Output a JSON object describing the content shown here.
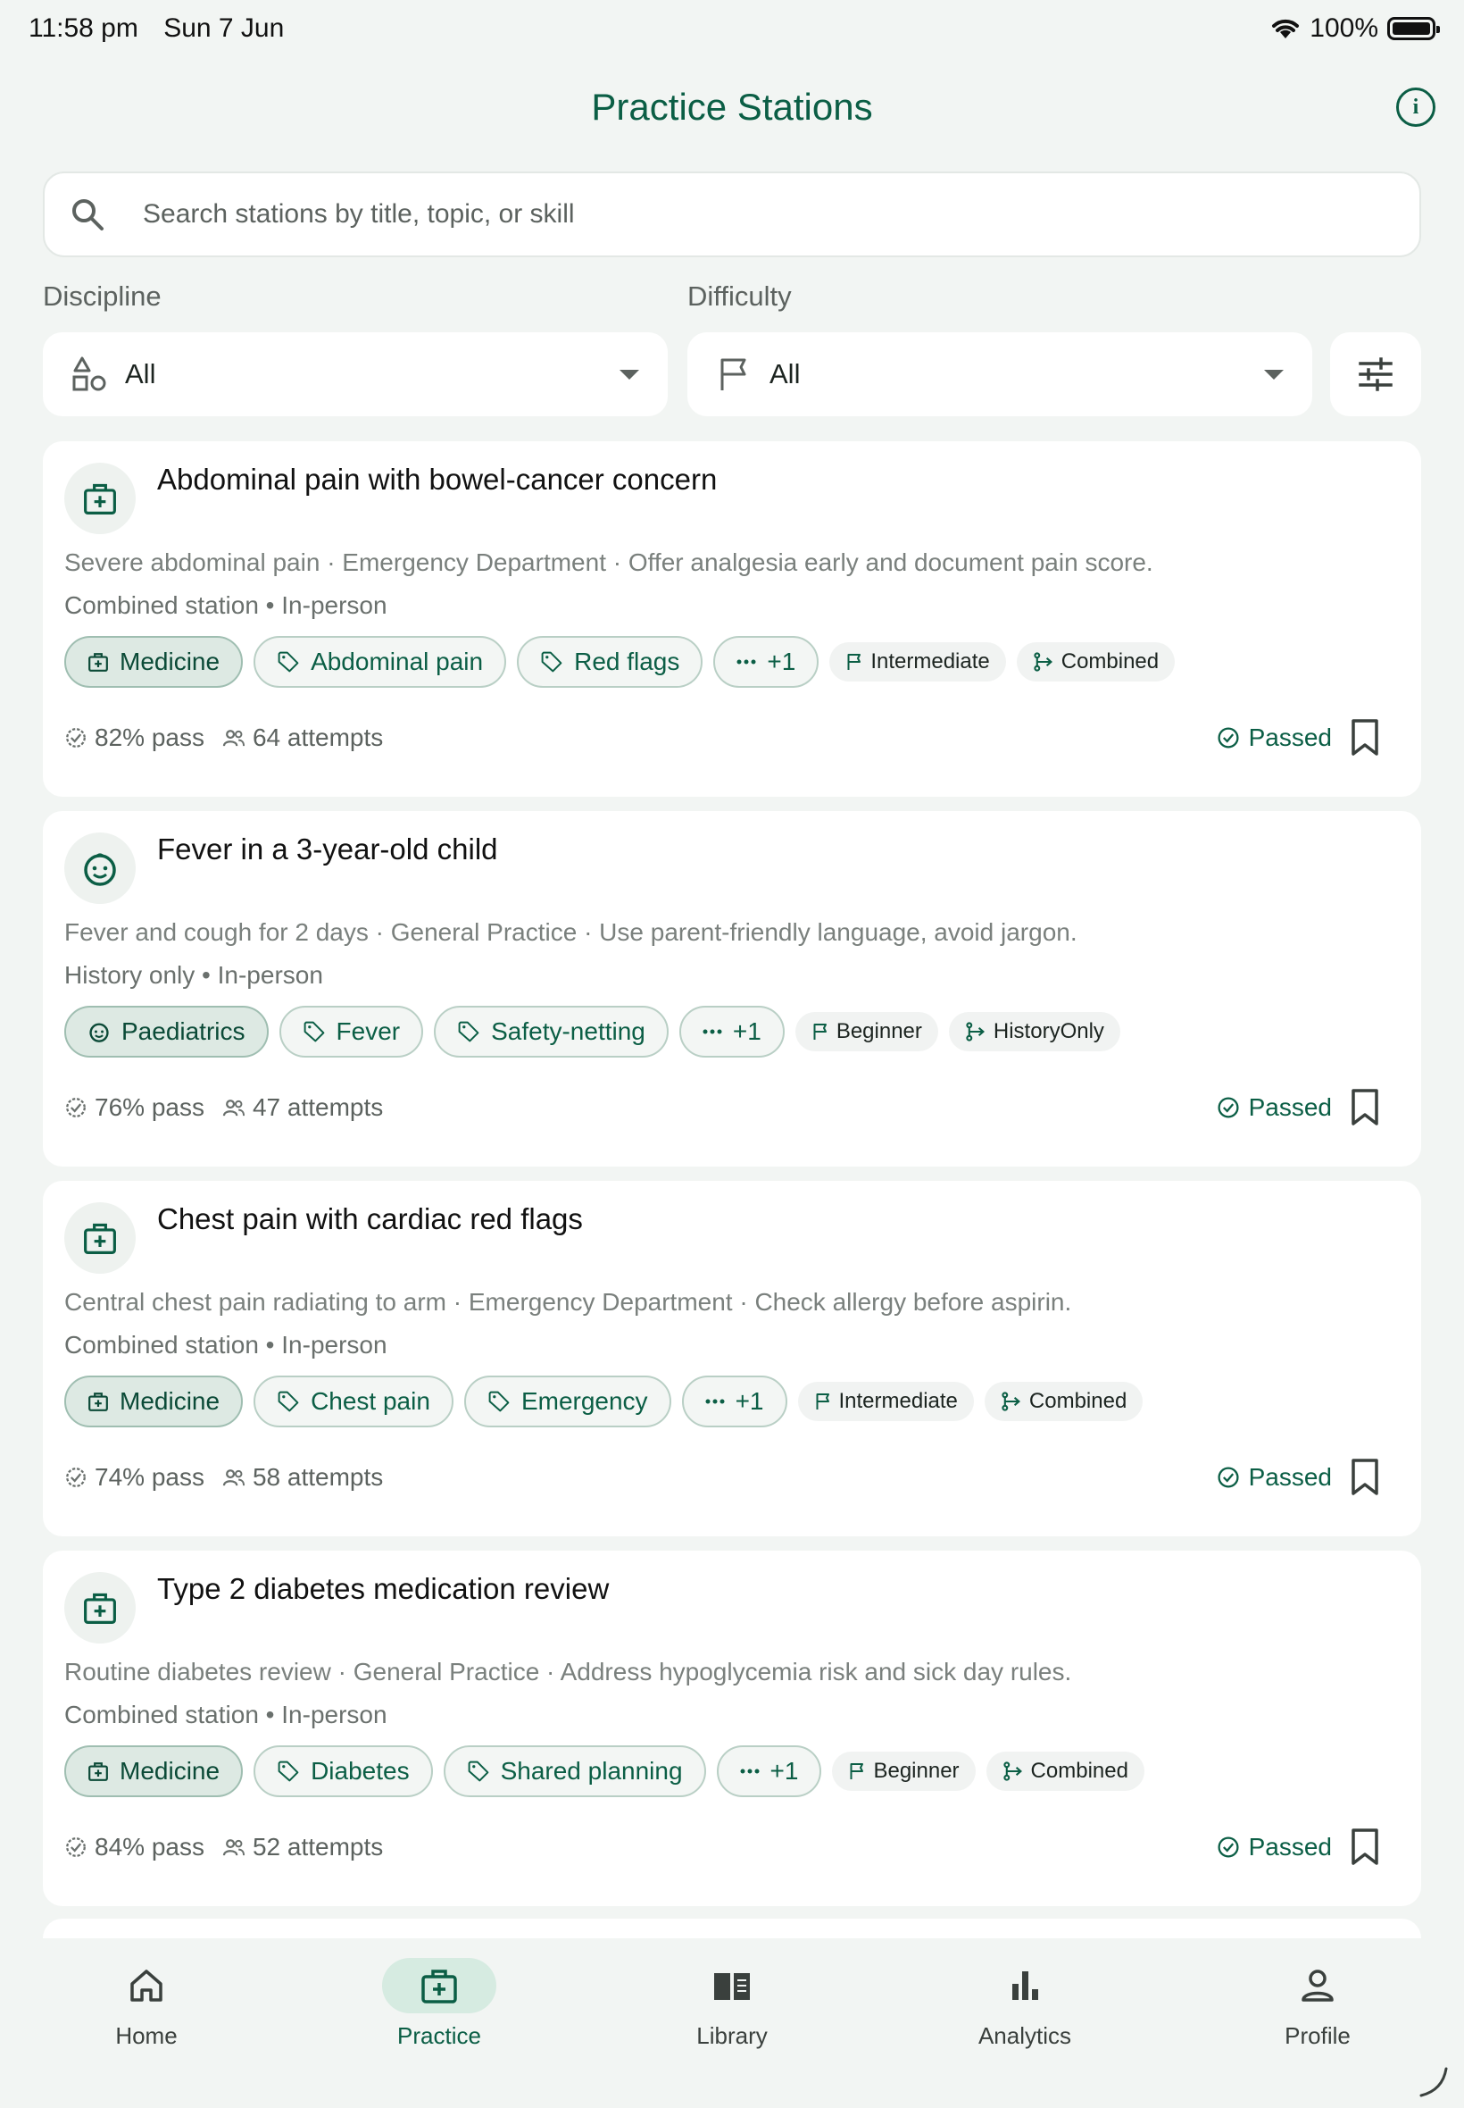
{
  "status_bar": {
    "time": "11:58 pm",
    "date": "Sun 7 Jun",
    "battery": "100%"
  },
  "header": {
    "title": "Practice Stations"
  },
  "search": {
    "placeholder": "Search stations by title, topic, or skill"
  },
  "filters": {
    "discipline": {
      "label": "Discipline",
      "value": "All"
    },
    "difficulty": {
      "label": "Difficulty",
      "value": "All"
    }
  },
  "colors": {
    "brand": "#0b5e45",
    "chip_active": "#dde9e3",
    "background": "#f2f5f3"
  },
  "stations": [
    {
      "icon": "medical-kit-icon",
      "title": "Abdominal pain with bowel-cancer concern",
      "description": "Severe abdominal pain · Emergency Department · Offer analgesia early and document pain score.",
      "meta": "Combined station • In-person",
      "discipline": "Medicine",
      "tags": [
        "Abdominal pain",
        "Red flags"
      ],
      "more": "+1",
      "difficulty": "Intermediate",
      "type": "Combined",
      "pass": "82% pass",
      "attempts": "64 attempts",
      "status": "Passed"
    },
    {
      "icon": "child-face-icon",
      "title": "Fever in a 3-year-old child",
      "description": "Fever and cough for 2 days · General Practice · Use parent-friendly language, avoid jargon.",
      "meta": "History only • In-person",
      "discipline": "Paediatrics",
      "tags": [
        "Fever",
        "Safety-netting"
      ],
      "more": "+1",
      "difficulty": "Beginner",
      "type": "HistoryOnly",
      "pass": "76% pass",
      "attempts": "47 attempts",
      "status": "Passed"
    },
    {
      "icon": "medical-kit-icon",
      "title": "Chest pain with cardiac red flags",
      "description": "Central chest pain radiating to arm · Emergency Department · Check allergy before aspirin.",
      "meta": "Combined station • In-person",
      "discipline": "Medicine",
      "tags": [
        "Chest pain",
        "Emergency"
      ],
      "more": "+1",
      "difficulty": "Intermediate",
      "type": "Combined",
      "pass": "74% pass",
      "attempts": "58 attempts",
      "status": "Passed"
    },
    {
      "icon": "medical-kit-icon",
      "title": "Type 2 diabetes medication review",
      "description": "Routine diabetes review · General Practice · Address hypoglycemia risk and sick day rules.",
      "meta": "Combined station • In-person",
      "discipline": "Medicine",
      "tags": [
        "Diabetes",
        "Shared planning"
      ],
      "more": "+1",
      "difficulty": "Beginner",
      "type": "Combined",
      "pass": "84% pass",
      "attempts": "52 attempts",
      "status": "Passed"
    }
  ],
  "bottom_nav": [
    {
      "label": "Home",
      "icon": "home-icon",
      "active": false
    },
    {
      "label": "Practice",
      "icon": "medical-kit-icon",
      "active": true
    },
    {
      "label": "Library",
      "icon": "book-icon",
      "active": false
    },
    {
      "label": "Analytics",
      "icon": "bar-chart-icon",
      "active": false
    },
    {
      "label": "Profile",
      "icon": "person-icon",
      "active": false
    }
  ]
}
